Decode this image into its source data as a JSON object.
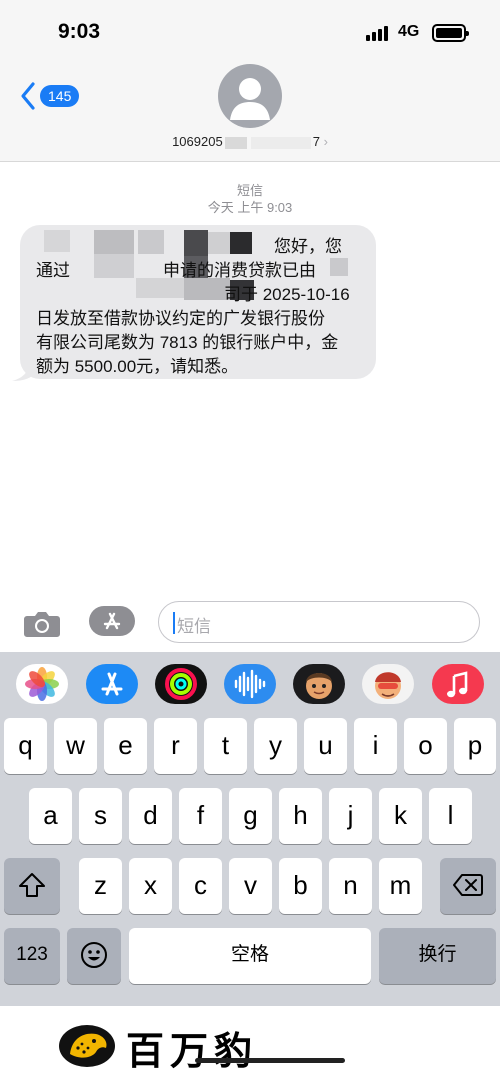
{
  "status_bar": {
    "time": "9:03",
    "network": "4G"
  },
  "header": {
    "back_count": "145",
    "contact_number_prefix": "1069205",
    "contact_number_suffix": "7"
  },
  "thread": {
    "service_label": "短信",
    "timestamp": "今天 上午 9:03",
    "message_lines": [
      "您好，您",
      "通过",
      "申请的消费贷款已由",
      "司于 2025-10-16",
      "日发放至借款协议约定的广发银行股份",
      "有限公司尾数为 7813 的银行账户中，金",
      "额为 5500.00元，请知悉。"
    ]
  },
  "compose": {
    "placeholder": "短信"
  },
  "keyboard": {
    "row1": [
      "q",
      "w",
      "e",
      "r",
      "t",
      "y",
      "u",
      "i",
      "o",
      "p"
    ],
    "row2": [
      "a",
      "s",
      "d",
      "f",
      "g",
      "h",
      "j",
      "k",
      "l"
    ],
    "row3": [
      "z",
      "x",
      "c",
      "v",
      "b",
      "n",
      "m"
    ],
    "numbers_key": "123",
    "space_key": "空格",
    "return_key": "换行"
  },
  "app_strip": [
    "photos-icon",
    "app-store-icon",
    "activity-icon",
    "audio-message-icon",
    "memoji-icon",
    "memoji-stickers-icon",
    "music-icon"
  ],
  "brand": {
    "name": "百万豹"
  },
  "colors": {
    "accent": "#1a7cf5",
    "bubble": "#e9e9eb",
    "keyboard_bg": "#d0d3d9"
  }
}
